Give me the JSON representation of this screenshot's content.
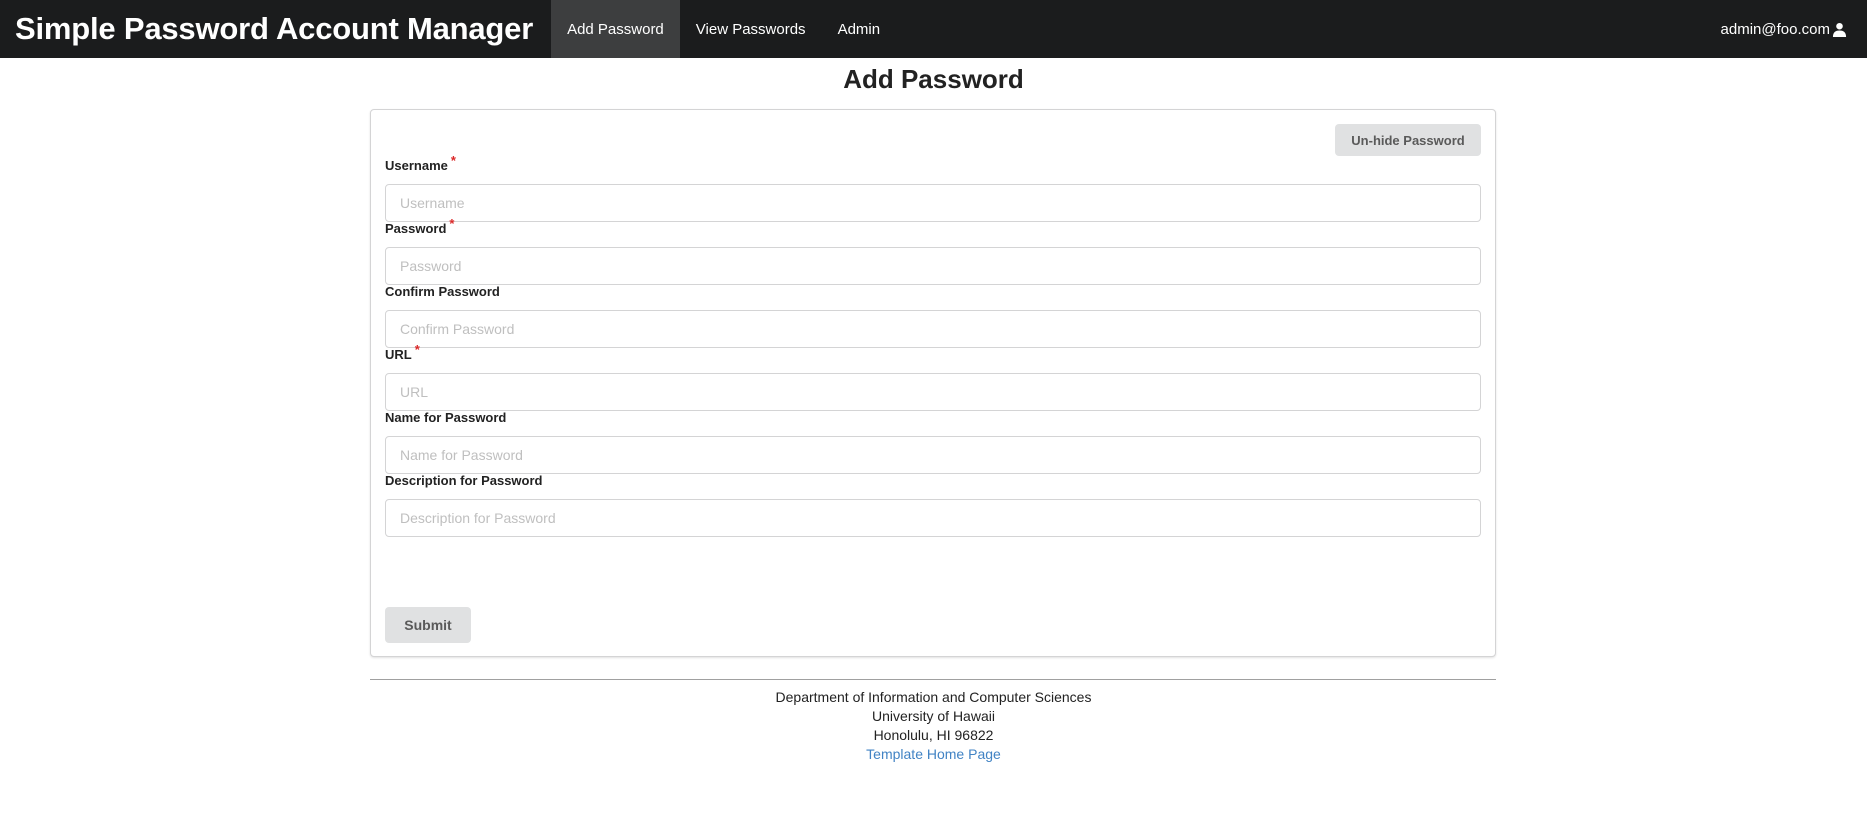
{
  "navbar": {
    "brand": "Simple Password Account Manager",
    "items": [
      {
        "label": "Add Password",
        "active": true
      },
      {
        "label": "View Passwords",
        "active": false
      },
      {
        "label": "Admin",
        "active": false
      }
    ],
    "user_email": "admin@foo.com",
    "user_icon": "user-icon"
  },
  "page": {
    "title": "Add Password"
  },
  "form": {
    "unhide_label": "Un-hide Password",
    "required_marker": "*",
    "fields": [
      {
        "label": "Username",
        "placeholder": "Username",
        "value": "",
        "required": true
      },
      {
        "label": "Password",
        "placeholder": "Password",
        "value": "",
        "required": true
      },
      {
        "label": "Confirm Password",
        "placeholder": "Confirm Password",
        "value": "",
        "required": false
      },
      {
        "label": "URL",
        "placeholder": "URL",
        "value": "",
        "required": true
      },
      {
        "label": "Name for Password",
        "placeholder": "Name for Password",
        "value": "",
        "required": false
      },
      {
        "label": "Description for Password",
        "placeholder": "Description for Password",
        "value": "",
        "required": false
      }
    ],
    "submit_label": "Submit"
  },
  "footer": {
    "line1": "Department of Information and Computer Sciences",
    "line2": "University of Hawaii",
    "line3": "Honolulu, HI 96822",
    "link": "Template Home Page"
  },
  "colors": {
    "navbar_bg": "#1b1c1d",
    "nav_active_bg": "#3d3e3f",
    "required": "#db2828",
    "link": "#4183c4",
    "button_bg": "#e0e1e2"
  }
}
